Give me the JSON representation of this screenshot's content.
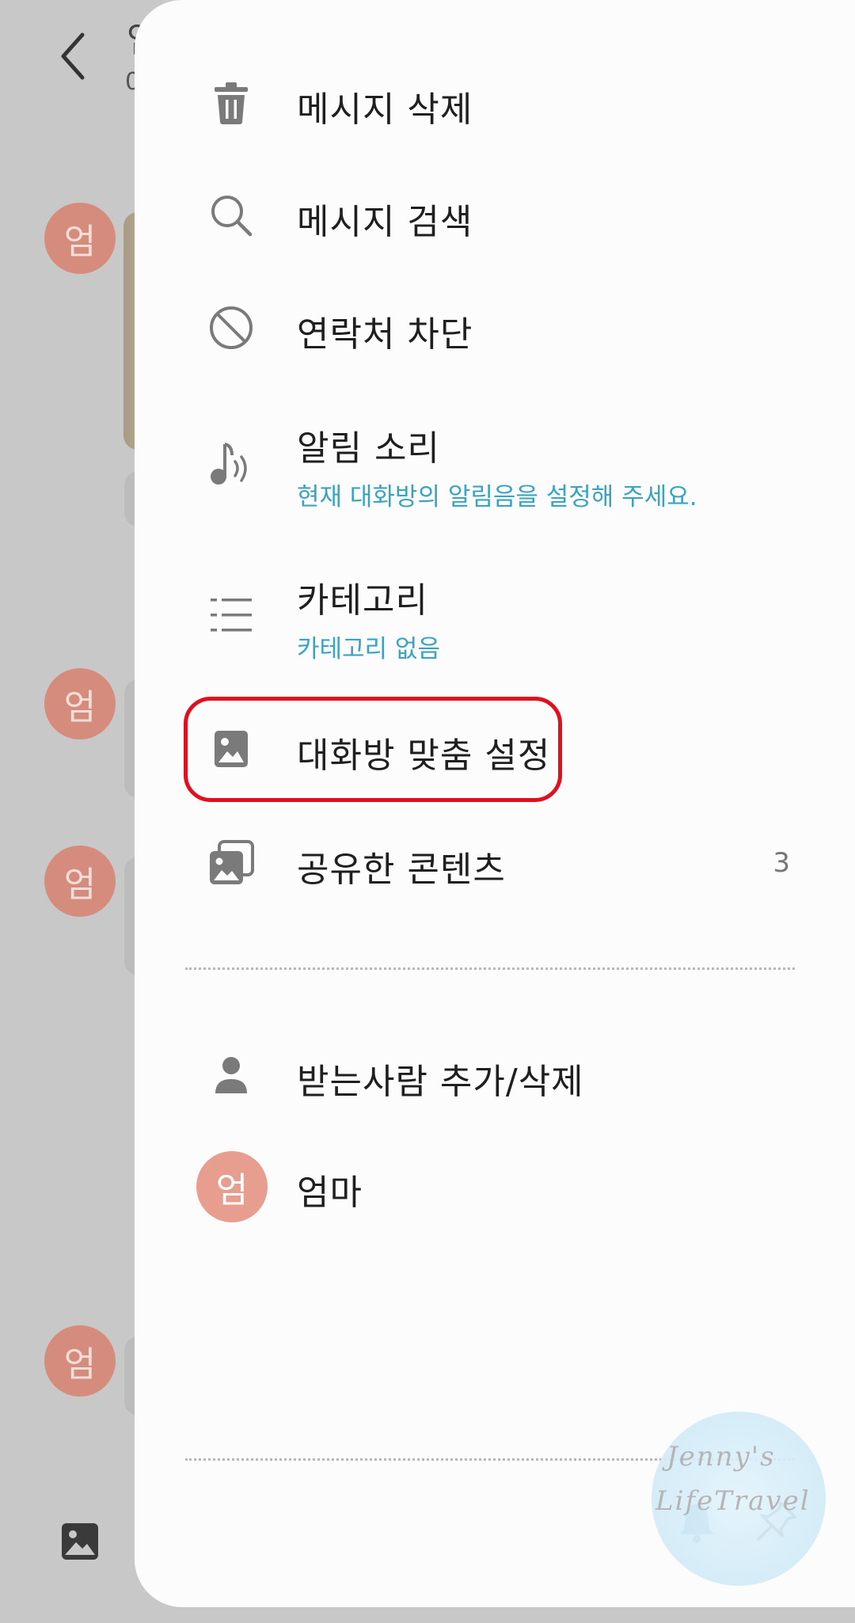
{
  "background": {
    "title_fragment": "엄",
    "subtitle_fragment": "0",
    "avatar_initial": "엄"
  },
  "drawer": {
    "items": [
      {
        "label": "메시지 삭제",
        "icon": "trash-icon"
      },
      {
        "label": "메시지 검색",
        "icon": "search-icon"
      },
      {
        "label": "연락처 차단",
        "icon": "block-icon"
      },
      {
        "label": "알림 소리",
        "sub": "현재 대화방의 알림음을 설정해 주세요.",
        "icon": "notification-sound-icon"
      },
      {
        "label": "카테고리",
        "sub": "카테고리 없음",
        "icon": "category-list-icon"
      },
      {
        "label": "대화방 맞춤 설정",
        "icon": "image-icon"
      },
      {
        "label": "공유한 콘텐츠",
        "count": "3",
        "icon": "shared-content-icon"
      },
      {
        "label": "받는사람 추가/삭제",
        "icon": "person-icon"
      }
    ],
    "member": {
      "initial": "엄",
      "name": "엄마"
    }
  },
  "watermark": {
    "line1": "Jenny's",
    "line2": "LifeTravel"
  },
  "colors": {
    "accent_sub": "#3aa3c0",
    "highlight": "#e0101e",
    "avatar": "#e89e8f"
  }
}
